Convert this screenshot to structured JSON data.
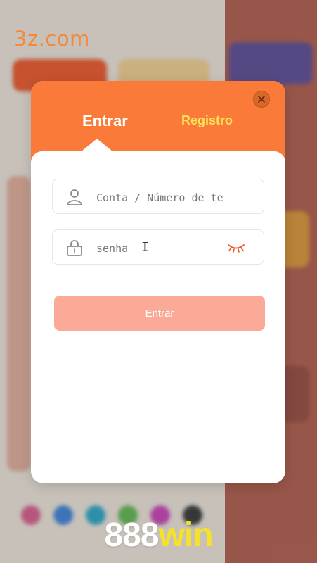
{
  "watermark": "3z.com",
  "modal": {
    "tabs": {
      "login": "Entrar",
      "register": "Registro"
    },
    "account_field": {
      "placeholder": "Conta / Número de te"
    },
    "password_field": {
      "placeholder": "senha"
    },
    "submit_label": "Entrar"
  },
  "brand": {
    "part1": "888",
    "part2": "win"
  },
  "colors": {
    "header": "#fa7a3a",
    "register_tab": "#fbe05a",
    "submit_disabled": "#fbaa97",
    "eye": "#f05a28"
  },
  "icons": [
    "user-icon",
    "lock-icon",
    "eye-closed-icon",
    "close-icon"
  ]
}
